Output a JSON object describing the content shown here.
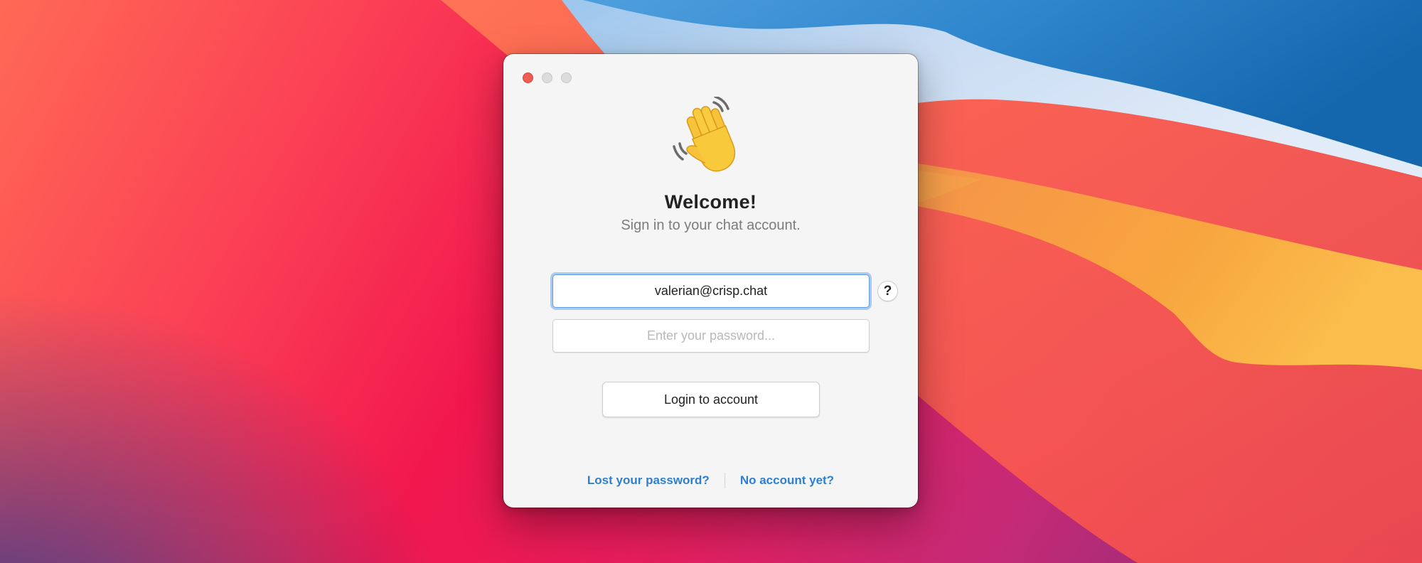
{
  "window": {
    "traffic_lights": [
      "close",
      "minimize",
      "maximize"
    ]
  },
  "header": {
    "icon": "waving-hand-emoji",
    "title": "Welcome!",
    "subtitle": "Sign in to your chat account."
  },
  "form": {
    "email_value": "valerian@crisp.chat",
    "password_placeholder": "Enter your password...",
    "help_label": "?",
    "login_label": "Login to account"
  },
  "footer": {
    "lost_password_label": "Lost your password?",
    "no_account_label": "No account yet?"
  },
  "colors": {
    "link": "#2f7fcf",
    "focus_ring": "#6ea5e8",
    "close_light": "#ee5d52"
  }
}
